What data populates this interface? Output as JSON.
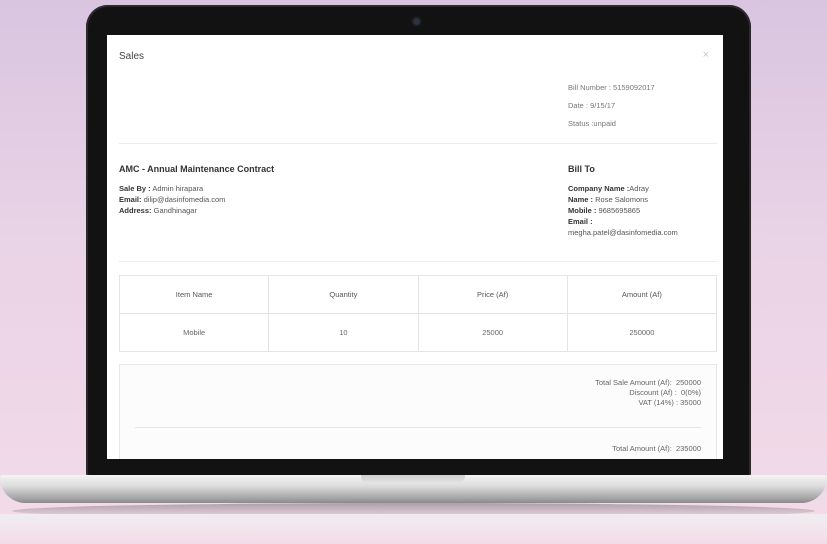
{
  "modal": {
    "title": "Sales",
    "close_label": "×"
  },
  "bill": {
    "number": "Bill Number : 5159092017",
    "date": "Date : 9/15/17",
    "status": "Status :unpaid"
  },
  "contract": {
    "title": "AMC - Annual Maintenance Contract",
    "sale_by_label": "Sale By :",
    "sale_by_value": "Admin hirapara",
    "email_label": "Email:",
    "email_value": "dilip@dasinfomedia.com",
    "address_label": "Address:",
    "address_value": "Gandhinagar"
  },
  "bill_to": {
    "title": "Bill To",
    "company_label": "Company Name :",
    "company_value": "Adray",
    "name_label": "Name :",
    "name_value": "Rose  Salomons",
    "mobile_label": "Mobile :",
    "mobile_value": "9685695865",
    "email_label": "Email :",
    "email_value": "megha.patel@dasinfomedia.com"
  },
  "items_table": {
    "headers": [
      "Item Name",
      "Quantity",
      "Price (Af)",
      "Amount (Af)"
    ],
    "rows": [
      [
        "Mobile",
        "10",
        "25000",
        "250000"
      ]
    ]
  },
  "totals": {
    "total_sale_label": "Total Sale Amount (Af):",
    "total_sale_value": "250000",
    "discount_label": "Discount (Af) :",
    "discount_value": "0(0%)",
    "vat_label": "VAT (14%) :",
    "vat_value": "35000",
    "total_amount_label": "Total Amount (Af):",
    "total_amount_value": "235000"
  }
}
